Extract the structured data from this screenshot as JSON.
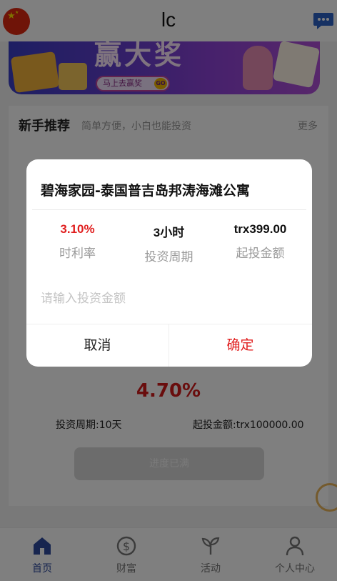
{
  "header": {
    "title": "lc"
  },
  "banner": {
    "headline": "赢大奖",
    "cta_label": "马上去赢奖",
    "go_label": "GO"
  },
  "section": {
    "title": "新手推荐",
    "subtitle": "简单方便，小白也能投资",
    "more_label": "更多"
  },
  "product": {
    "rate": "4.70%",
    "period": "投资周期:10天",
    "min_amount": "起投金额:trx100000.00",
    "status_button": "进度已满"
  },
  "dialog": {
    "title": "碧海家园-泰国普吉岛邦涛海滩公寓",
    "stats": [
      {
        "value": "3.10%",
        "label": "时利率"
      },
      {
        "value": "3小时",
        "label": "投资周期"
      },
      {
        "value": "trx399.00",
        "label": "起投金额"
      }
    ],
    "amount_placeholder": "请输入投资金额",
    "cancel_label": "取消",
    "confirm_label": "确定"
  },
  "tabs": [
    {
      "label": "首页",
      "icon": "home-icon",
      "active": true
    },
    {
      "label": "财富",
      "icon": "dollar-circle-icon",
      "active": false
    },
    {
      "label": "活动",
      "icon": "sprout-icon",
      "active": false
    },
    {
      "label": "个人中心",
      "icon": "user-icon",
      "active": false
    }
  ],
  "colors": {
    "accent": "#e01e1e",
    "tab_active": "#2e4a9e",
    "overlay": "rgba(0,0,0,0.5)"
  }
}
